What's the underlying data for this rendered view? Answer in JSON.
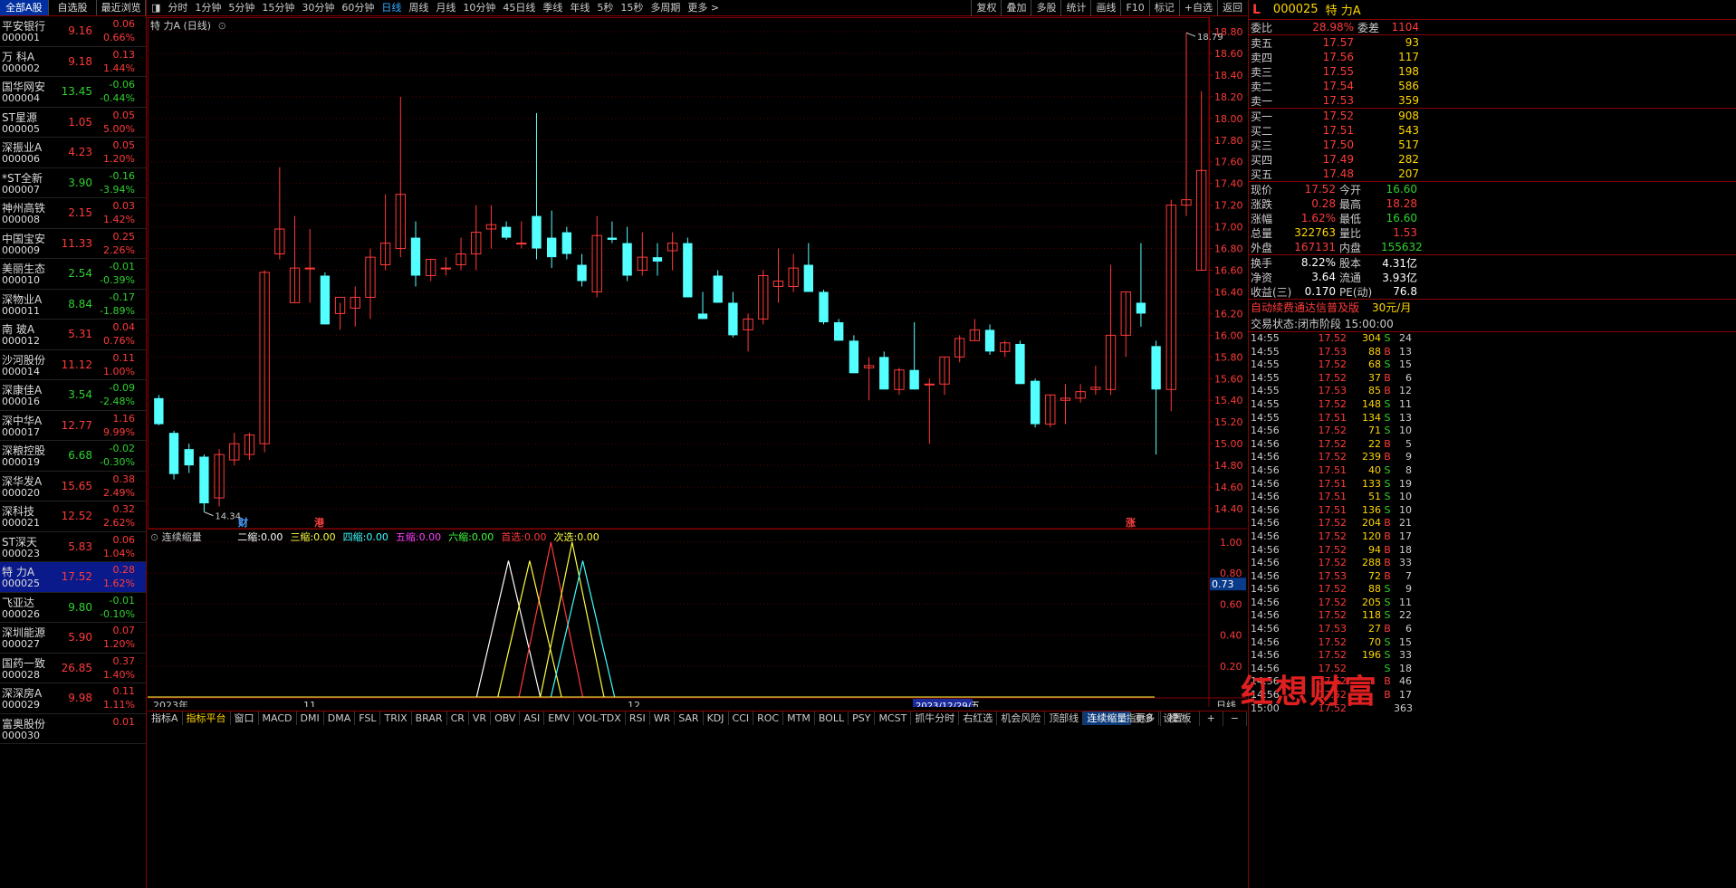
{
  "left_tabs": [
    "全部A股",
    "自选股",
    "最近浏览"
  ],
  "stocks": [
    {
      "name": "平安银行",
      "code": "000001",
      "price": "9.16",
      "chg": "0.06",
      "pct": "0.66%",
      "dir": "up"
    },
    {
      "name": "万 科A",
      "code": "000002",
      "price": "9.18",
      "chg": "0.13",
      "pct": "1.44%",
      "dir": "up"
    },
    {
      "name": "国华网安",
      "code": "000004",
      "price": "13.45",
      "chg": "-0.06",
      "pct": "-0.44%",
      "dir": "dn"
    },
    {
      "name": "ST星源",
      "code": "000005",
      "price": "1.05",
      "chg": "0.05",
      "pct": "5.00%",
      "dir": "up"
    },
    {
      "name": "深振业A",
      "code": "000006",
      "price": "4.23",
      "chg": "0.05",
      "pct": "1.20%",
      "dir": "up"
    },
    {
      "name": "*ST全新",
      "code": "000007",
      "price": "3.90",
      "chg": "-0.16",
      "pct": "-3.94%",
      "dir": "dn"
    },
    {
      "name": "神州高铁",
      "code": "000008",
      "price": "2.15",
      "chg": "0.03",
      "pct": "1.42%",
      "dir": "up"
    },
    {
      "name": "中国宝安",
      "code": "000009",
      "price": "11.33",
      "chg": "0.25",
      "pct": "2.26%",
      "dir": "up"
    },
    {
      "name": "美丽生态",
      "code": "000010",
      "price": "2.54",
      "chg": "-0.01",
      "pct": "-0.39%",
      "dir": "dn"
    },
    {
      "name": "深物业A",
      "code": "000011",
      "price": "8.84",
      "chg": "-0.17",
      "pct": "-1.89%",
      "dir": "dn"
    },
    {
      "name": "南 玻A",
      "code": "000012",
      "price": "5.31",
      "chg": "0.04",
      "pct": "0.76%",
      "dir": "up"
    },
    {
      "name": "沙河股份",
      "code": "000014",
      "price": "11.12",
      "chg": "0.11",
      "pct": "1.00%",
      "dir": "up"
    },
    {
      "name": "深康佳A",
      "code": "000016",
      "price": "3.54",
      "chg": "-0.09",
      "pct": "-2.48%",
      "dir": "dn"
    },
    {
      "name": "深中华A",
      "code": "000017",
      "price": "12.77",
      "chg": "1.16",
      "pct": "9.99%",
      "dir": "up"
    },
    {
      "name": "深粮控股",
      "code": "000019",
      "price": "6.68",
      "chg": "-0.02",
      "pct": "-0.30%",
      "dir": "dn"
    },
    {
      "name": "深华发A",
      "code": "000020",
      "price": "15.65",
      "chg": "0.38",
      "pct": "2.49%",
      "dir": "up"
    },
    {
      "name": "深科技",
      "code": "000021",
      "price": "12.52",
      "chg": "0.32",
      "pct": "2.62%",
      "dir": "up"
    },
    {
      "name": "ST深天",
      "code": "000023",
      "price": "5.83",
      "chg": "0.06",
      "pct": "1.04%",
      "dir": "up"
    },
    {
      "name": "特 力A",
      "code": "000025",
      "price": "17.52",
      "chg": "0.28",
      "pct": "1.62%",
      "dir": "up",
      "sel": true
    },
    {
      "name": "飞亚达",
      "code": "000026",
      "price": "9.80",
      "chg": "-0.01",
      "pct": "-0.10%",
      "dir": "dn"
    },
    {
      "name": "深圳能源",
      "code": "000027",
      "price": "5.90",
      "chg": "0.07",
      "pct": "1.20%",
      "dir": "up"
    },
    {
      "name": "国药一致",
      "code": "000028",
      "price": "26.85",
      "chg": "0.37",
      "pct": "1.40%",
      "dir": "up"
    },
    {
      "name": "深深房A",
      "code": "000029",
      "price": "9.98",
      "chg": "0.11",
      "pct": "1.11%",
      "dir": "up"
    },
    {
      "name": "富奥股份",
      "code": "000030",
      "price": "",
      "chg": "0.01",
      "pct": "",
      "dir": "up"
    }
  ],
  "toolbar": [
    "分时",
    "1分钟",
    "5分钟",
    "15分钟",
    "30分钟",
    "60分钟",
    "日线",
    "周线",
    "月线",
    "10分钟",
    "45日线",
    "季线",
    "年线",
    "5秒",
    "15秒",
    "多周期",
    "更多 >"
  ],
  "toolbar_active": "日线",
  "toolbar_right": [
    "复权",
    "叠加",
    "多股",
    "统计",
    "画线",
    "F10",
    "标记",
    "+自选",
    "返回"
  ],
  "chart_title": "特 力A (日线)",
  "indicator": {
    "name": "连续缩量",
    "items": [
      {
        "label": "二缩:",
        "value": "0.00",
        "color": "#ffffff"
      },
      {
        "label": "三缩:",
        "value": "0.00",
        "color": "#ffff40"
      },
      {
        "label": "四缩:",
        "value": "0.00",
        "color": "#40ffff"
      },
      {
        "label": "五缩:",
        "value": "0.00",
        "color": "#ff40ff"
      },
      {
        "label": "六缩:",
        "value": "0.00",
        "color": "#40ff40"
      },
      {
        "label": "首选:",
        "value": "0.00",
        "color": "#ff3a3a"
      },
      {
        "label": "次选:",
        "value": "0.00",
        "color": "#ffff40"
      }
    ]
  },
  "price_axis": [
    "18.80",
    "18.60",
    "18.40",
    "18.20",
    "18.00",
    "17.80",
    "17.60",
    "17.40",
    "17.20",
    "17.00",
    "16.80",
    "16.60",
    "16.40",
    "16.20",
    "16.00",
    "15.80",
    "15.60",
    "15.40",
    "15.20",
    "15.00",
    "14.80",
    "14.60",
    "14.40"
  ],
  "ind_axis": [
    "1.00",
    "0.80",
    "0.60",
    "0.40",
    "0.20"
  ],
  "ind_cursor": "0.73",
  "high_label": "18.79",
  "low_label": "14.34",
  "markers": [
    {
      "text": "财",
      "color": "#4aa0ff"
    },
    {
      "text": "港",
      "color": "#ff4040"
    },
    {
      "text": "涨",
      "color": "#ff4040"
    }
  ],
  "date_labels": [
    "2023年",
    "11",
    "12",
    "2023/12/29/五"
  ],
  "period_label": "日线",
  "bottom_tabs": [
    "指标A",
    "指标平台",
    "窗口",
    "MACD",
    "DMI",
    "DMA",
    "FSL",
    "TRIX",
    "BRAR",
    "CR",
    "VR",
    "OBV",
    "ASI",
    "EMV",
    "VOL-TDX",
    "RSI",
    "WR",
    "SAR",
    "KDJ",
    "CCI",
    "ROC",
    "MTM",
    "BOLL",
    "PSY",
    "MCST",
    "抓牛分时",
    "右红选",
    "机会风险",
    "顶部线",
    "连续缩量",
    "更多",
    "设置"
  ],
  "bottom_active": "连续缩量",
  "bottom_right": [
    "指标B",
    "模 板",
    "+",
    "−"
  ],
  "chart_data": {
    "type": "candlestick",
    "ylim": [
      14.3,
      18.85
    ],
    "ohlc": [
      [
        15.42,
        15.45,
        15.17,
        15.18
      ],
      [
        15.1,
        15.12,
        14.67,
        14.72
      ],
      [
        14.95,
        15.0,
        14.73,
        14.8
      ],
      [
        14.88,
        14.9,
        14.37,
        14.45
      ],
      [
        14.5,
        14.95,
        14.42,
        14.9
      ],
      [
        14.85,
        15.1,
        14.8,
        15.0
      ],
      [
        14.9,
        15.1,
        14.85,
        15.08
      ],
      [
        15.0,
        16.6,
        14.92,
        16.58
      ],
      [
        16.75,
        17.55,
        16.7,
        16.98
      ],
      [
        16.3,
        17.1,
        16.3,
        16.62
      ],
      [
        16.62,
        16.98,
        16.3,
        16.62
      ],
      [
        16.55,
        16.58,
        16.1,
        16.1
      ],
      [
        16.2,
        16.3,
        16.05,
        16.35
      ],
      [
        16.25,
        16.45,
        16.08,
        16.35
      ],
      [
        16.35,
        16.8,
        16.15,
        16.72
      ],
      [
        16.65,
        17.3,
        16.6,
        16.85
      ],
      [
        16.8,
        18.2,
        16.72,
        17.3
      ],
      [
        16.9,
        17.05,
        16.45,
        16.55
      ],
      [
        16.55,
        16.7,
        16.5,
        16.7
      ],
      [
        16.62,
        16.72,
        16.55,
        16.62
      ],
      [
        16.65,
        16.9,
        16.6,
        16.75
      ],
      [
        16.75,
        17.2,
        16.6,
        16.95
      ],
      [
        16.98,
        17.2,
        16.8,
        17.02
      ],
      [
        17.0,
        17.05,
        16.88,
        16.9
      ],
      [
        16.85,
        17.05,
        16.8,
        16.85
      ],
      [
        17.1,
        18.05,
        16.7,
        16.8
      ],
      [
        16.9,
        17.15,
        16.62,
        16.72
      ],
      [
        16.95,
        17.0,
        16.7,
        16.75
      ],
      [
        16.65,
        16.75,
        16.45,
        16.5
      ],
      [
        16.4,
        17.1,
        16.35,
        16.92
      ],
      [
        16.9,
        17.05,
        16.85,
        16.88
      ],
      [
        16.85,
        17.0,
        16.5,
        16.55
      ],
      [
        16.6,
        16.95,
        16.55,
        16.72
      ],
      [
        16.72,
        16.85,
        16.55,
        16.68
      ],
      [
        16.78,
        16.95,
        16.6,
        16.85
      ],
      [
        16.85,
        16.9,
        16.35,
        16.35
      ],
      [
        16.2,
        16.4,
        16.15,
        16.15
      ],
      [
        16.55,
        16.6,
        16.3,
        16.3
      ],
      [
        16.3,
        16.4,
        15.98,
        16.0
      ],
      [
        16.05,
        16.2,
        15.85,
        16.15
      ],
      [
        16.15,
        16.6,
        16.1,
        16.55
      ],
      [
        16.45,
        16.8,
        16.3,
        16.5
      ],
      [
        16.45,
        16.75,
        16.4,
        16.62
      ],
      [
        16.65,
        16.85,
        16.4,
        16.4
      ],
      [
        16.4,
        16.42,
        16.1,
        16.12
      ],
      [
        16.12,
        16.15,
        15.95,
        15.95
      ],
      [
        15.95,
        16.0,
        15.65,
        15.65
      ],
      [
        15.7,
        15.8,
        15.4,
        15.72
      ],
      [
        15.8,
        15.85,
        15.5,
        15.5
      ],
      [
        15.5,
        15.7,
        15.45,
        15.68
      ],
      [
        15.68,
        16.12,
        15.5,
        15.5
      ],
      [
        15.55,
        15.6,
        15.0,
        15.55
      ],
      [
        15.55,
        15.8,
        15.45,
        15.8
      ],
      [
        15.8,
        16.0,
        15.75,
        15.97
      ],
      [
        15.95,
        16.15,
        15.95,
        16.05
      ],
      [
        16.05,
        16.1,
        15.82,
        15.85
      ],
      [
        15.85,
        15.95,
        15.8,
        15.93
      ],
      [
        15.92,
        15.95,
        15.55,
        15.55
      ],
      [
        15.58,
        15.6,
        15.15,
        15.18
      ],
      [
        15.18,
        15.45,
        15.15,
        15.45
      ],
      [
        15.4,
        15.55,
        15.18,
        15.42
      ],
      [
        15.42,
        15.55,
        15.38,
        15.48
      ],
      [
        15.5,
        15.72,
        15.45,
        15.52
      ],
      [
        15.5,
        16.65,
        15.45,
        16.0
      ],
      [
        16.0,
        16.4,
        15.8,
        16.4
      ],
      [
        16.3,
        16.85,
        16.08,
        16.2
      ],
      [
        15.9,
        15.95,
        14.9,
        15.5
      ],
      [
        15.5,
        17.25,
        15.3,
        17.2
      ],
      [
        17.2,
        18.79,
        17.1,
        17.25
      ],
      [
        16.6,
        18.25,
        16.6,
        17.52
      ]
    ],
    "indicator_series": [
      {
        "name": "二缩",
        "color": "#ffffff",
        "points": [
          [
            0.31,
            0
          ],
          [
            0.34,
            0.88
          ],
          [
            0.37,
            0
          ]
        ]
      },
      {
        "name": "首选",
        "color": "#ff3a3a",
        "points": [
          [
            0.35,
            0
          ],
          [
            0.38,
            1.0
          ],
          [
            0.41,
            0
          ]
        ]
      },
      {
        "name": "三缩",
        "color": "#ffff40",
        "points": [
          [
            0.33,
            0
          ],
          [
            0.36,
            0.88
          ],
          [
            0.39,
            0
          ]
        ]
      },
      {
        "name": "次选",
        "color": "#ffff40",
        "points": [
          [
            0.37,
            0
          ],
          [
            0.4,
            1.0
          ],
          [
            0.43,
            0
          ]
        ]
      },
      {
        "name": "四缩",
        "color": "#40ffff",
        "points": [
          [
            0.38,
            0
          ],
          [
            0.41,
            0.88
          ],
          [
            0.44,
            0
          ]
        ]
      }
    ]
  },
  "quote": {
    "header_label": "L",
    "code": "000025",
    "name": "特 力A",
    "ratio": {
      "label": "委比",
      "value": "28.98%",
      "label2": "委差",
      "value2": "1104"
    },
    "asks": [
      {
        "l": "卖五",
        "p": "17.57",
        "v": "93"
      },
      {
        "l": "卖四",
        "p": "17.56",
        "v": "117"
      },
      {
        "l": "卖三",
        "p": "17.55",
        "v": "198"
      },
      {
        "l": "卖二",
        "p": "17.54",
        "v": "586"
      },
      {
        "l": "卖一",
        "p": "17.53",
        "v": "359"
      }
    ],
    "bids": [
      {
        "l": "买一",
        "p": "17.52",
        "v": "908"
      },
      {
        "l": "买二",
        "p": "17.51",
        "v": "543"
      },
      {
        "l": "买三",
        "p": "17.50",
        "v": "517"
      },
      {
        "l": "买四",
        "p": "17.49",
        "v": "282"
      },
      {
        "l": "买五",
        "p": "17.48",
        "v": "207"
      }
    ],
    "stats": [
      [
        {
          "l": "现价",
          "v": "17.52",
          "c": "up"
        },
        {
          "l": "今开",
          "v": "16.60",
          "c": "dn"
        }
      ],
      [
        {
          "l": "涨跌",
          "v": "0.28",
          "c": "up"
        },
        {
          "l": "最高",
          "v": "18.28",
          "c": "up"
        }
      ],
      [
        {
          "l": "涨幅",
          "v": "1.62%",
          "c": "up"
        },
        {
          "l": "最低",
          "v": "16.60",
          "c": "dn"
        }
      ],
      [
        {
          "l": "总量",
          "v": "322763",
          "c": "y"
        },
        {
          "l": "量比",
          "v": "1.53",
          "c": "up"
        }
      ],
      [
        {
          "l": "外盘",
          "v": "167131",
          "c": "up"
        },
        {
          "l": "内盘",
          "v": "155632",
          "c": "dn"
        }
      ]
    ],
    "stats2": [
      [
        {
          "l": "换手",
          "v": "8.22%"
        },
        {
          "l": "股本",
          "v": "4.31亿"
        }
      ],
      [
        {
          "l": "净资",
          "v": "3.64"
        },
        {
          "l": "流通",
          "v": "3.93亿"
        }
      ],
      [
        {
          "l": "收益(三)",
          "v": "0.170"
        },
        {
          "l": "PE(动)",
          "v": "76.8"
        }
      ]
    ],
    "ad": "自动续费通达信普及版",
    "ad_price": "30元/月",
    "status_label": "交易状态:",
    "status": "闭市阶段 15:00:00"
  },
  "ticks": [
    [
      "14:55",
      "17.52",
      "304",
      "S",
      "24"
    ],
    [
      "14:55",
      "17.53",
      "88",
      "B",
      "13"
    ],
    [
      "14:55",
      "17.52",
      "68",
      "S",
      "15"
    ],
    [
      "14:55",
      "17.52",
      "37",
      "B",
      "6"
    ],
    [
      "14:55",
      "17.53",
      "85",
      "B",
      "12"
    ],
    [
      "14:55",
      "17.52",
      "148",
      "S",
      "11"
    ],
    [
      "14:55",
      "17.51",
      "134",
      "S",
      "13"
    ],
    [
      "14:56",
      "17.52",
      "71",
      "S",
      "10"
    ],
    [
      "14:56",
      "17.52",
      "22",
      "B",
      "5"
    ],
    [
      "14:56",
      "17.52",
      "239",
      "B",
      "9"
    ],
    [
      "14:56",
      "17.51",
      "40",
      "S",
      "8"
    ],
    [
      "14:56",
      "17.51",
      "133",
      "S",
      "19"
    ],
    [
      "14:56",
      "17.51",
      "51",
      "S",
      "10"
    ],
    [
      "14:56",
      "17.51",
      "136",
      "S",
      "10"
    ],
    [
      "14:56",
      "17.52",
      "204",
      "B",
      "21"
    ],
    [
      "14:56",
      "17.52",
      "120",
      "B",
      "17"
    ],
    [
      "14:56",
      "17.52",
      "94",
      "B",
      "18"
    ],
    [
      "14:56",
      "17.52",
      "288",
      "B",
      "33"
    ],
    [
      "14:56",
      "17.53",
      "72",
      "B",
      "7"
    ],
    [
      "14:56",
      "17.52",
      "88",
      "S",
      "9"
    ],
    [
      "14:56",
      "17.52",
      "205",
      "S",
      "11"
    ],
    [
      "14:56",
      "17.52",
      "118",
      "S",
      "22"
    ],
    [
      "14:56",
      "17.53",
      "27",
      "B",
      "6"
    ],
    [
      "14:56",
      "17.52",
      "70",
      "S",
      "15"
    ],
    [
      "14:56",
      "17.52",
      "196",
      "S",
      "33"
    ],
    [
      "14:56",
      "17.52",
      "",
      "S",
      "18"
    ],
    [
      "14:56",
      "17.52",
      "",
      "B",
      "46"
    ],
    [
      "14:56",
      "17.52",
      "",
      "B",
      "17"
    ],
    [
      "15:00",
      "17.52",
      "",
      "",
      "363"
    ]
  ],
  "watermark": "红想财富"
}
